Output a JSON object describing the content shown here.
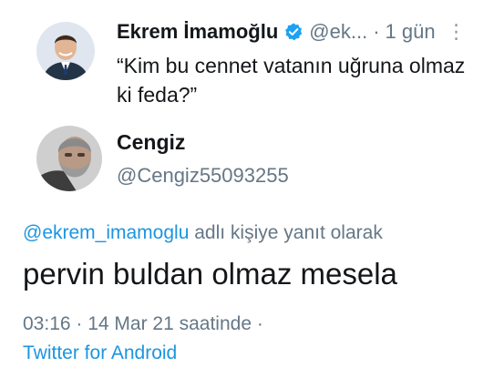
{
  "original_tweet": {
    "author_name": "Ekrem İmamoğlu",
    "handle": "@ek...",
    "separator": "·",
    "time_ago": "1 gün",
    "more_glyph": "⋮",
    "text": "“Kim bu cennet vatanın uğruna olmaz ki feda?”",
    "avatar_icon": "profile-photo-icon",
    "verified_icon": "verified-badge-icon"
  },
  "reply": {
    "author_name": "Cengiz",
    "handle": "@Cengiz55093255",
    "avatar_icon": "profile-photo-icon",
    "replying_mention": "@ekrem_imamoglu",
    "replying_suffix": " adlı kişiye yanıt olarak",
    "text": "pervin buldan olmaz mesela",
    "timestamp": "03:16 · 14 Mar 21 saatinde ·",
    "source": "Twitter for Android"
  },
  "colors": {
    "text_primary": "#14171a",
    "text_secondary": "#657786",
    "link": "#1b95e0",
    "verified": "#1da1f2"
  }
}
